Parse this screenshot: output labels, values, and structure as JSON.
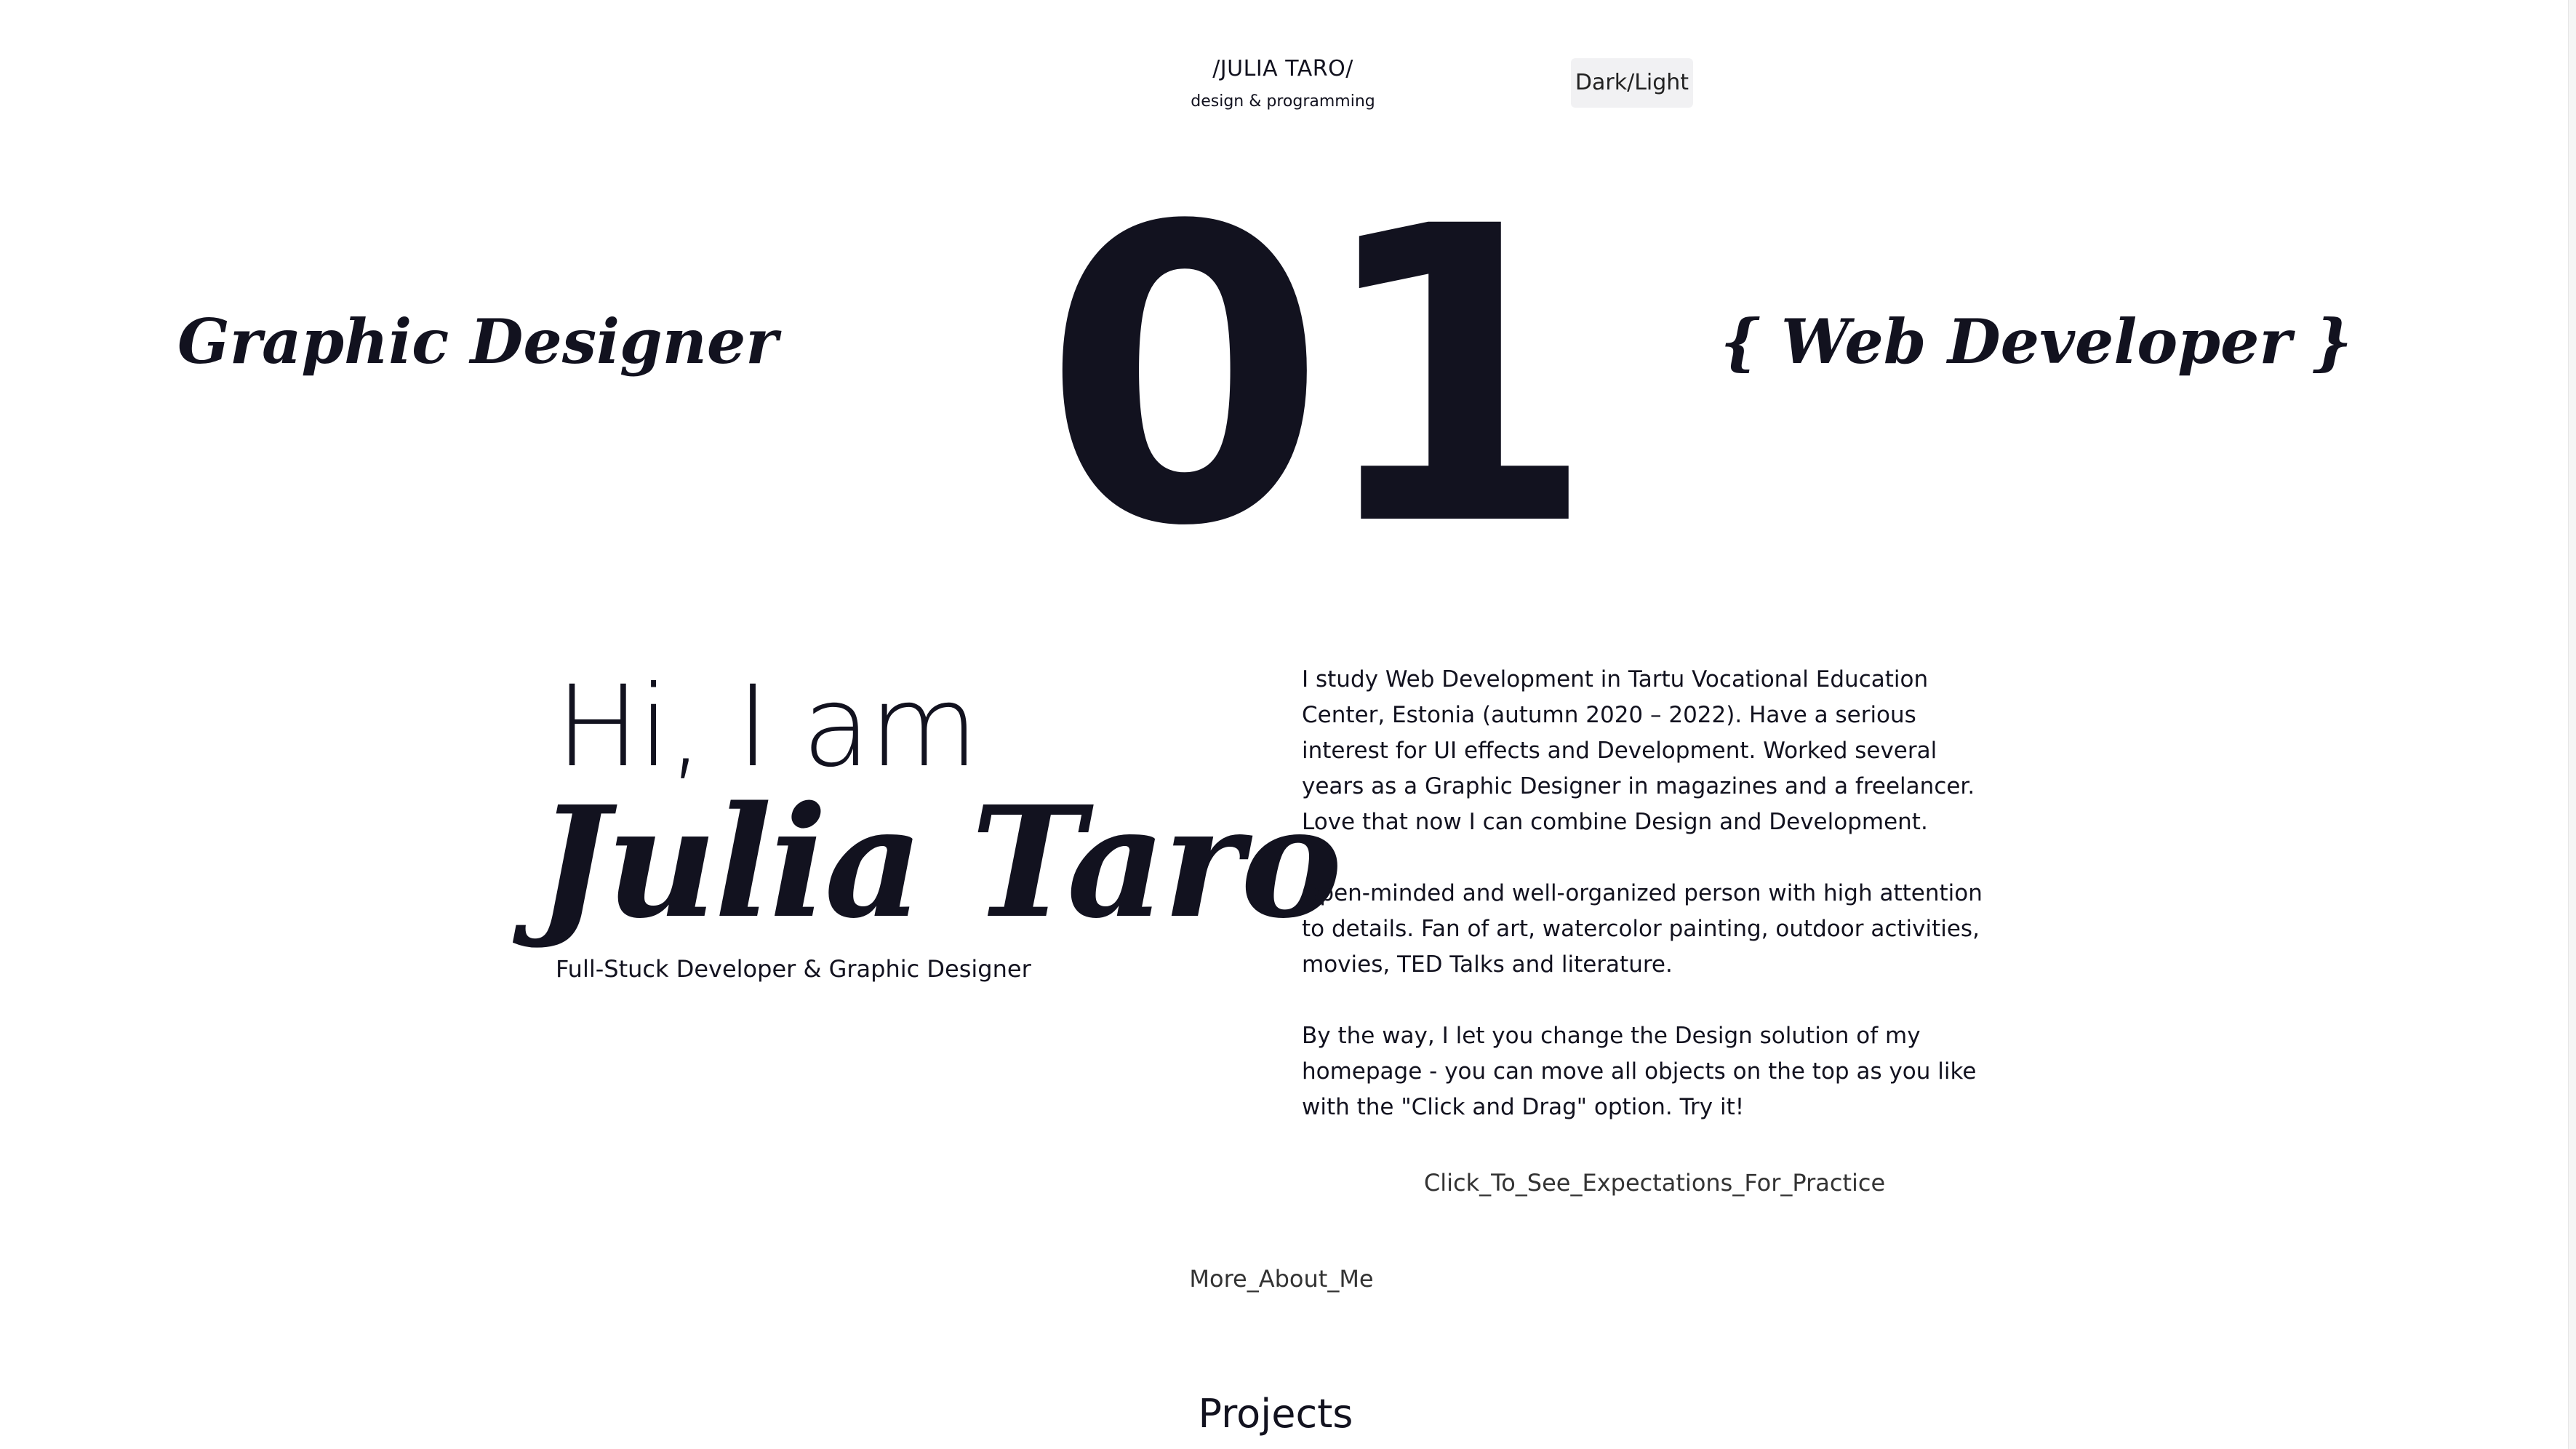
{
  "header": {
    "brand_title": "/JULIA TARO/",
    "brand_subtitle": "design & programming",
    "theme_toggle_label": "Dark/Light"
  },
  "hero": {
    "left_title": "Graphic Designer",
    "right_title": "{ Web Developer }",
    "big_number": "01"
  },
  "intro": {
    "greeting": "Hi, I am",
    "name": "Julia Taro",
    "tagline": "Full-Stuck Developer & Graphic Designer"
  },
  "bio": {
    "paragraphs": [
      "I study Web Development in Tartu Vocational Education Center, Estonia (autumn 2020 – 2022). Have a serious interest for UI effects and Development. Worked several years as a Graphic Designer in magazines and a freelancer. Love that now I can combine Design and Development.",
      "Open-minded and well-organized person with high attention to details. Fan of art, watercolor painting, outdoor activities, movies, TED Talks and literature.",
      "By the way, I let you change the Design solution of my homepage - you can move all objects on the top as you like with the \"Click and Drag\" option. Try it!"
    ],
    "expectations_link": "Click_To_See_Expectations_For_Practice"
  },
  "more_link": "More_About_Me",
  "projects_heading": "Projects",
  "colors": {
    "text": "#12121f",
    "background": "#ffffff",
    "toggle_bg": "#f1f1f3"
  }
}
